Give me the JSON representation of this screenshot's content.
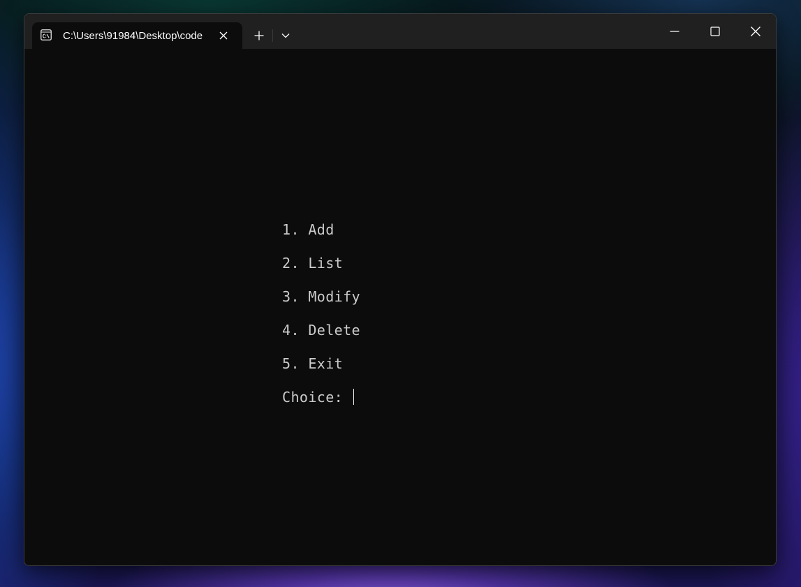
{
  "window": {
    "tab_title": "C:\\Users\\91984\\Desktop\\code",
    "icons": {
      "tab": "cmd-icon",
      "close_tab": "close-icon",
      "new_tab": "plus-icon",
      "dropdown": "chevron-down-icon",
      "minimize": "minimize-icon",
      "maximize": "maximize-icon",
      "close": "close-icon"
    }
  },
  "terminal": {
    "menu_items": [
      "1. Add",
      "2. List",
      "3. Modify",
      "4. Delete",
      "5. Exit"
    ],
    "prompt": "Choice: "
  },
  "colors": {
    "terminal_bg": "#0c0c0c",
    "titlebar_bg": "#202020",
    "text": "#cccccc"
  }
}
